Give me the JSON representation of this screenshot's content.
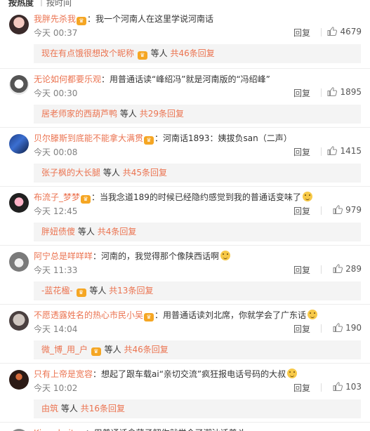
{
  "sort": {
    "hot": "按热度",
    "time": "按时间"
  },
  "comments": [
    {
      "user": "我胖先杀我",
      "badge": "♛",
      "text": "：我一个河南人在这里学说河南话",
      "emoji": false,
      "time": "今天 00:37",
      "reply": "回复",
      "likes": "4679",
      "sub": {
        "who": "现在有点饿很想改个昵称",
        "badge": true,
        "etc": "等人",
        "count": "共46条回复"
      }
    },
    {
      "user": "无论如何都要乐观",
      "badge": "",
      "text": "：用普通话读“峰绍冯”就是河南版的“冯绍峰”",
      "emoji": false,
      "time": "今天 00:30",
      "reply": "回复",
      "likes": "1895",
      "sub": {
        "who": "居老师家的西葫芦鸭",
        "badge": false,
        "etc": "等人",
        "count": "共29条回复"
      }
    },
    {
      "user": "贝尔滕斯到底能不能拿大满贯",
      "badge": "♛",
      "text": "：河南话1893：姨拔负san（二声）",
      "emoji": false,
      "time": "今天 00:08",
      "reply": "回复",
      "likes": "1415",
      "sub": {
        "who": "张子枫的大长腿",
        "badge": false,
        "etc": "等人",
        "count": "共45条回复"
      }
    },
    {
      "user": "布流子_梦梦",
      "badge": "♛",
      "text": "：当我念道189的时候已经隐约感觉到我的普通话变味了",
      "emoji": true,
      "time": "今天 12:45",
      "reply": "回复",
      "likes": "979",
      "sub": {
        "who": "胖妞债傻",
        "badge": false,
        "etc": "等人",
        "count": "共4条回复"
      }
    },
    {
      "user": "阿宁总是咩咩咩",
      "badge": "",
      "text": "：河南的，我觉得那个像陕西话啊",
      "emoji": true,
      "time": "今天 11:33",
      "reply": "回复",
      "likes": "289",
      "sub": {
        "who": "-蓝花楹-",
        "badge": true,
        "etc": "等人",
        "count": "共13条回复"
      }
    },
    {
      "user": "不愿透露姓名的热心市民小吴",
      "badge": "♛",
      "text": "：用普通话读刘北席，你就学会了广东话",
      "emoji": true,
      "time": "今天 14:04",
      "reply": "回复",
      "likes": "190",
      "sub": {
        "who": "微_博_用_户",
        "badge": true,
        "etc": "等人",
        "count": "共46条回复"
      }
    },
    {
      "user": "只有上帝是宽容",
      "badge": "",
      "text": "：想起了跟车载ai“亲切交流”疯狂报电话号码的大叔",
      "emoji": true,
      "time": "今天 10:02",
      "reply": "回复",
      "likes": "103",
      "sub": {
        "who": "由筑",
        "badge": false,
        "etc": "等人",
        "count": "共16条回复"
      }
    },
    {
      "user": "Kimadmit",
      "badge": "♛",
      "text": "：用普通话念蒲子韶你就学会了潮汕话普斗",
      "emoji": false,
      "time": "",
      "reply": "",
      "likes": "",
      "sub": null
    }
  ],
  "colors": {
    "username": "#eb7350",
    "time": "#808080",
    "sub_bg": "#f4f4f4"
  }
}
